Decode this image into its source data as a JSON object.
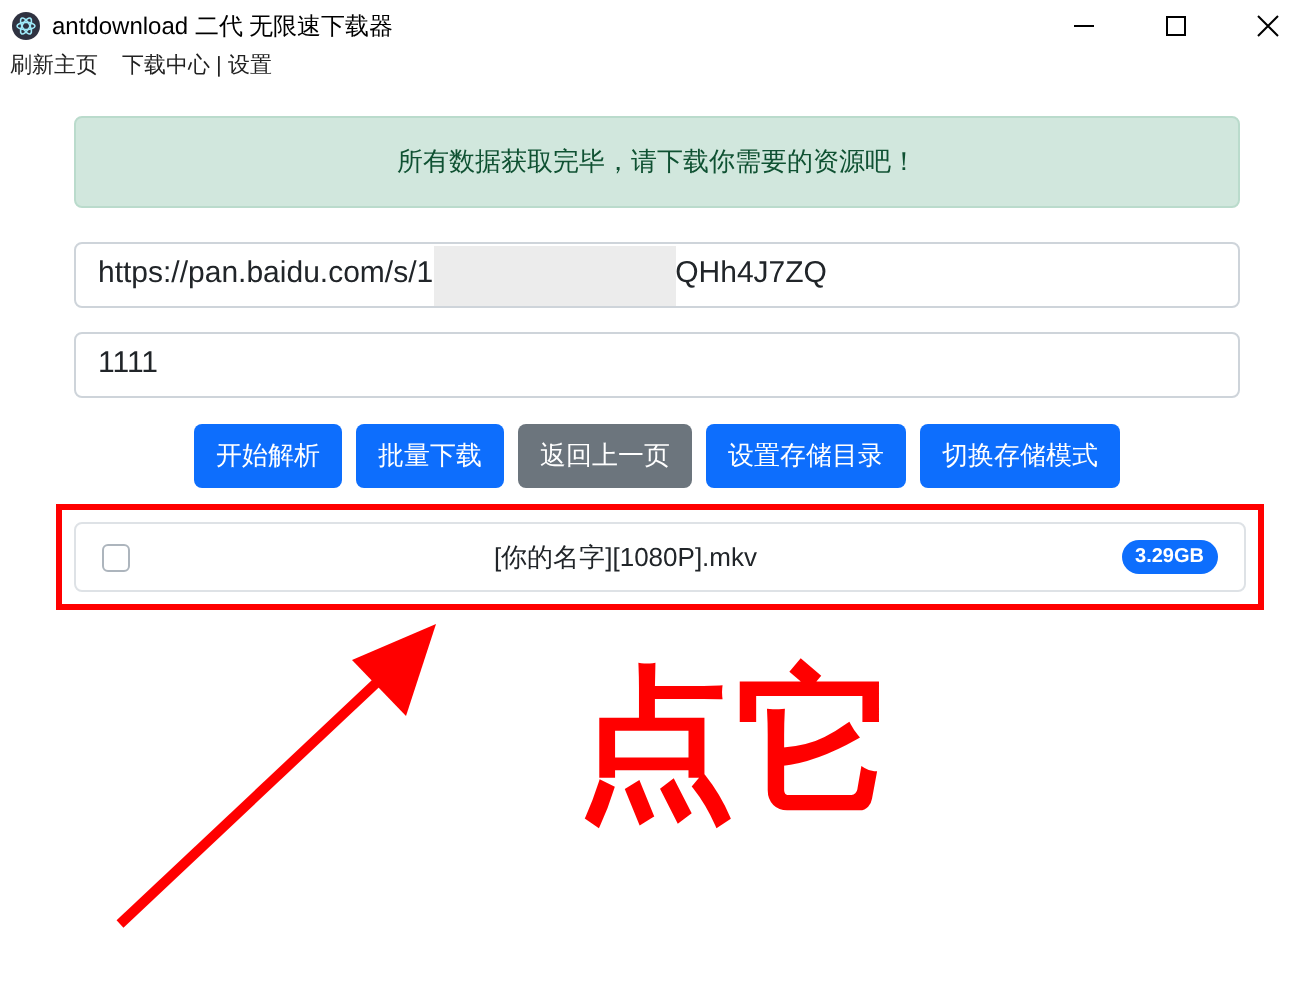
{
  "window": {
    "title": "antdownload 二代 无限速下载器"
  },
  "menu": [
    {
      "label": "刷新主页"
    },
    {
      "label": "下载中心"
    },
    {
      "label": "|"
    },
    {
      "label": "设置"
    }
  ],
  "alert": {
    "text": "所有数据获取完毕，请下载你需要的资源吧！"
  },
  "link_field": {
    "value_start": "https://pan.baidu.com/s/1",
    "value_end": "QHh4J7ZQ"
  },
  "code_field": {
    "value": "1111"
  },
  "buttons": [
    {
      "label": "开始解析",
      "kind": "primary"
    },
    {
      "label": "批量下载",
      "kind": "primary"
    },
    {
      "label": "返回上一页",
      "kind": "secondary"
    },
    {
      "label": "设置存储目录",
      "kind": "primary"
    },
    {
      "label": "切换存储模式",
      "kind": "primary"
    }
  ],
  "files": [
    {
      "name": "[你的名字][1080P].mkv",
      "size": "3.29GB",
      "checked": false
    }
  ],
  "annotation": {
    "text": "点它"
  }
}
